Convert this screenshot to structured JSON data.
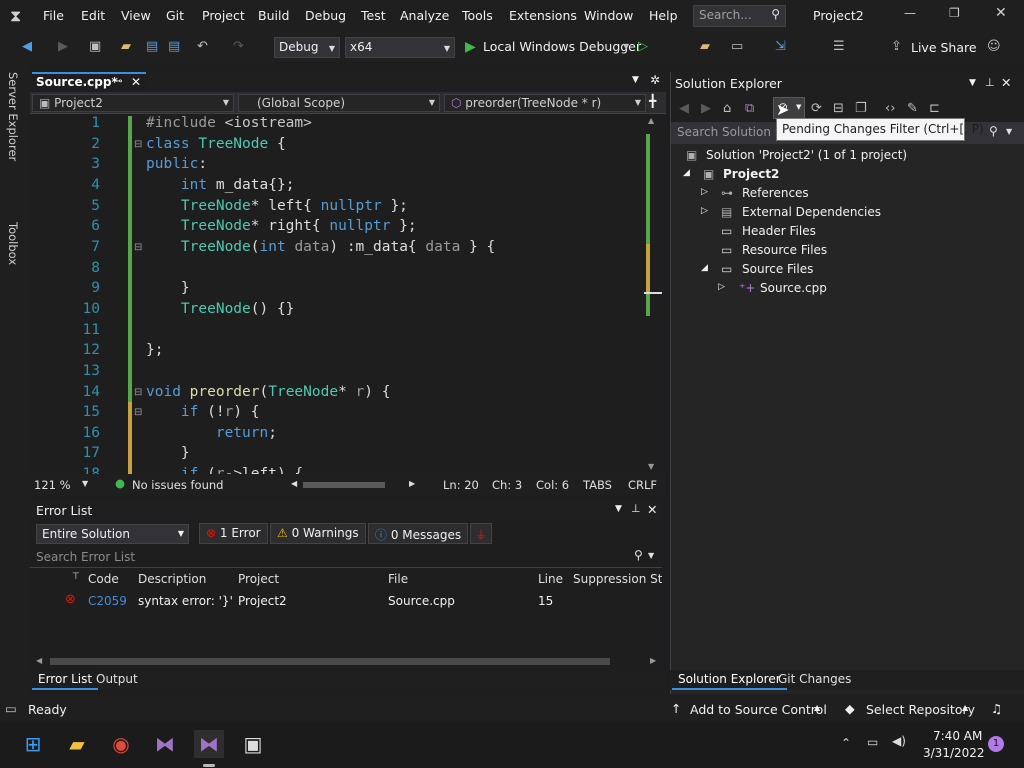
{
  "menu": {
    "items": [
      "File",
      "Edit",
      "View",
      "Git",
      "Project",
      "Build",
      "Debug",
      "Test",
      "Analyze",
      "Tools",
      "Extensions",
      "Window",
      "Help"
    ],
    "search_placeholder": "Search...",
    "project_title": "Project2"
  },
  "toolbar": {
    "config": "Debug",
    "platform": "x64",
    "run_label": "Local Windows Debugger",
    "live_share": "Live Share"
  },
  "left_tabs": {
    "server_explorer": "Server Explorer",
    "toolbox": "Toolbox"
  },
  "editor": {
    "tab_title": "Source.cpp*",
    "nav": {
      "project": "Project2",
      "scope": "(Global Scope)",
      "member": "preorder(TreeNode * r)"
    },
    "zoom": "121 %",
    "issues": "No issues found",
    "ln": "Ln: 20",
    "ch": "Ch: 3",
    "col": "Col: 6",
    "tabs": "TABS",
    "eol": "CRLF",
    "line_numbers": [
      "1",
      "2",
      "3",
      "4",
      "5",
      "6",
      "7",
      "8",
      "9",
      "10",
      "11",
      "12",
      "13",
      "14",
      "15",
      "16",
      "17",
      "18"
    ]
  },
  "error_list": {
    "title": "Error List",
    "scope": "Entire Solution",
    "errors": "1 Error",
    "warnings": "0 Warnings",
    "messages": "0 Messages",
    "search_placeholder": "Search Error List",
    "columns": [
      "Code",
      "Description",
      "Project",
      "File",
      "Line",
      "Suppression State"
    ],
    "rows": [
      {
        "code": "C2059",
        "description": "syntax error: '}'",
        "project": "Project2",
        "file": "Source.cpp",
        "line": "15"
      }
    ]
  },
  "bottom_tabs": [
    "Error List",
    "Output"
  ],
  "solution_explorer": {
    "title": "Solution Explorer",
    "search_placeholder": "Search Solution Explorer",
    "tooltip": "Pending Changes Filter (Ctrl+[, P)",
    "solution": "Solution 'Project2' (1 of 1 project)",
    "project": "Project2",
    "nodes": [
      "References",
      "External Dependencies",
      "Header Files",
      "Resource Files",
      "Source Files",
      "Source.cpp"
    ],
    "tabs": [
      "Solution Explorer",
      "Git Changes"
    ]
  },
  "status": {
    "ready": "Ready",
    "source_control": "Add to Source Control",
    "repository": "Select Repository"
  },
  "taskbar": {
    "time": "7:40 AM",
    "date": "3/31/2022",
    "notifications": "1"
  }
}
